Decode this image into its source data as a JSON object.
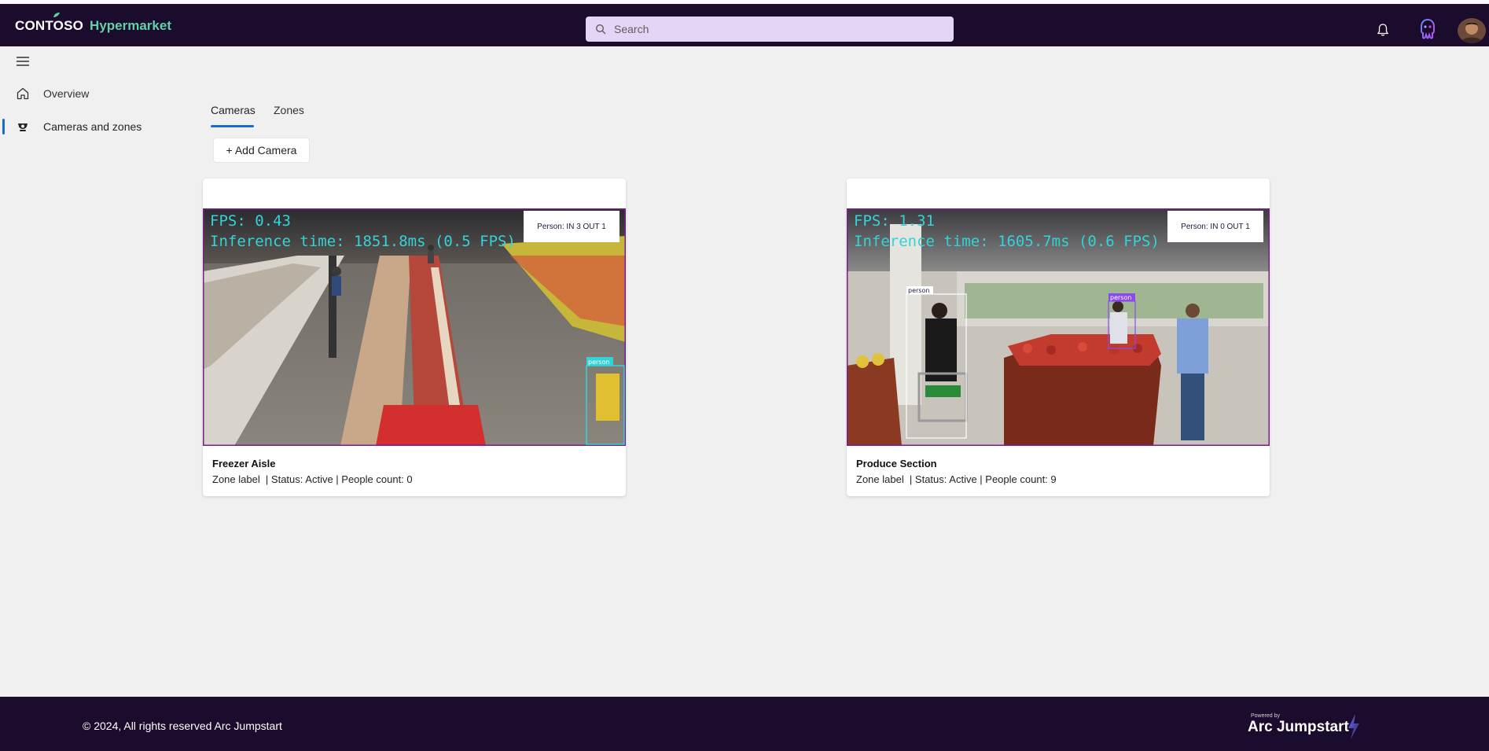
{
  "brand": {
    "name": "CONTOSO",
    "sub": "Hypermarket",
    "accent": "#5fd1a5"
  },
  "header": {
    "bg": "#1b0c2e",
    "search_placeholder": "Search"
  },
  "sidebar": {
    "items": [
      {
        "label": "Overview",
        "icon": "home-icon"
      },
      {
        "label": "Cameras and zones",
        "icon": "camera-icon",
        "active": true
      }
    ]
  },
  "tabs": [
    {
      "label": "Cameras",
      "active": true
    },
    {
      "label": "Zones",
      "active": false
    }
  ],
  "add_camera_label": "+ Add Camera",
  "cameras": [
    {
      "title": "Freezer Aisle",
      "meta": "Zone label  | Status: Active | People count: 0",
      "fps": "FPS: 0.43",
      "inference": "Inference time: 1851.8ms (0.5 FPS)",
      "counter": "Person: IN 3 OUT 1",
      "detections": [
        "person"
      ]
    },
    {
      "title": "Produce Section",
      "meta": "Zone label  | Status: Active | People count: 9",
      "fps": "FPS: 1.31",
      "inference": "Inference time: 1605.7ms (0.6 FPS)",
      "counter": "Person: IN 0 OUT 1",
      "detections": [
        "person",
        "person"
      ]
    }
  ],
  "footer": {
    "copyright": "© 2024, All rights reserved Arc Jumpstart",
    "powered_by": "Powered by",
    "logo_text": "Arc Jumpstart"
  }
}
